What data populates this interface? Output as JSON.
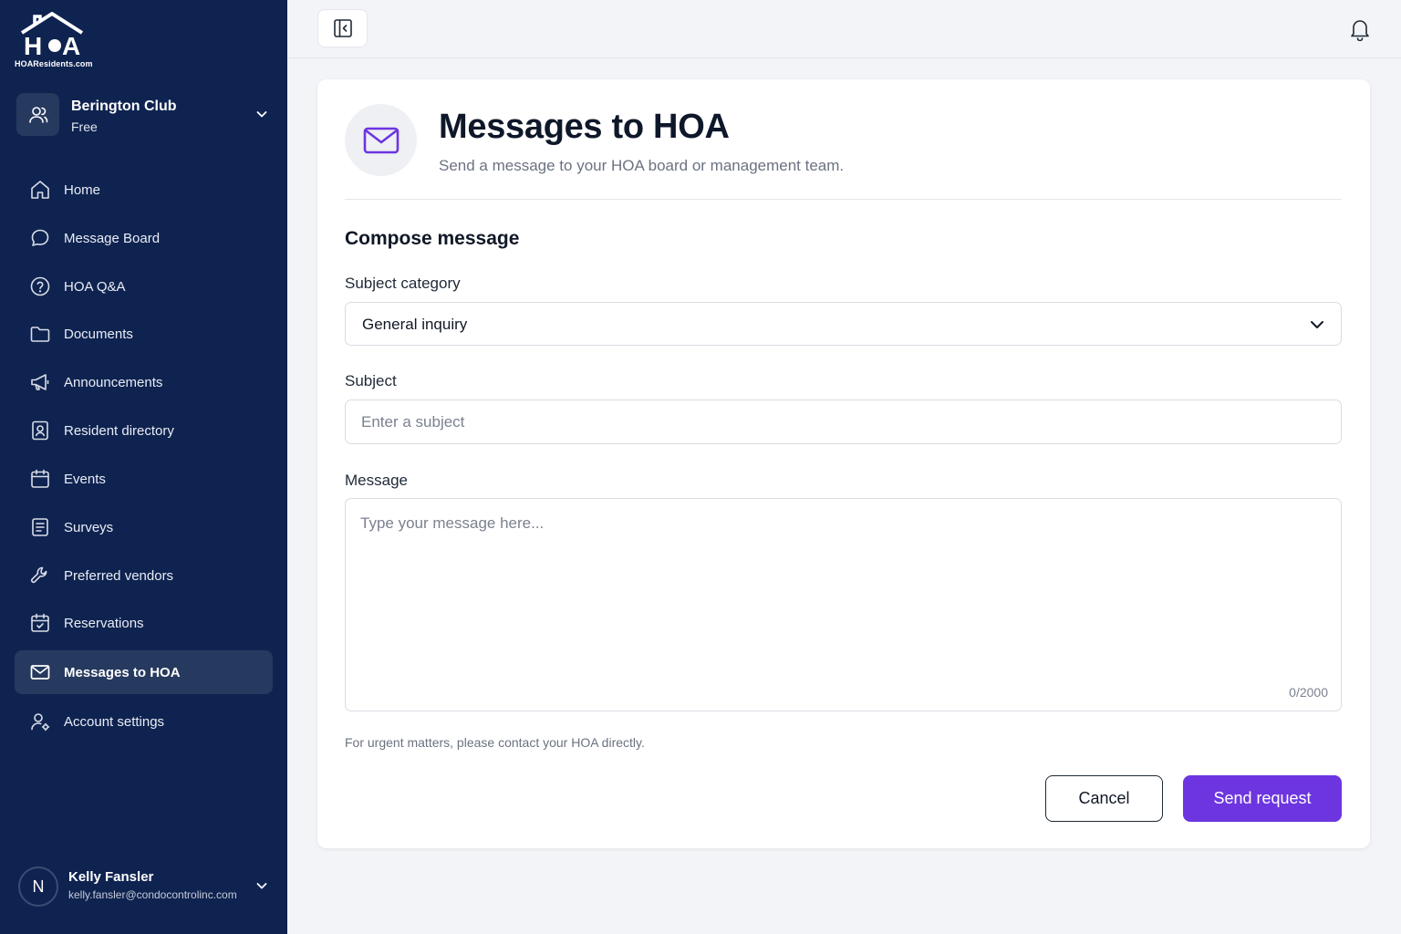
{
  "brand": {
    "logo_text": "HOA",
    "caption": "HOAResidents.com"
  },
  "org": {
    "name": "Berington Club",
    "plan": "Free"
  },
  "nav": [
    {
      "label": "Home",
      "icon": "home-icon"
    },
    {
      "label": "Message Board",
      "icon": "chat-bubble-icon"
    },
    {
      "label": "HOA Q&A",
      "icon": "question-circle-icon"
    },
    {
      "label": "Documents",
      "icon": "folder-icon"
    },
    {
      "label": "Announcements",
      "icon": "megaphone-icon"
    },
    {
      "label": "Resident directory",
      "icon": "contact-card-icon"
    },
    {
      "label": "Events",
      "icon": "calendar-icon"
    },
    {
      "label": "Surveys",
      "icon": "clipboard-list-icon"
    },
    {
      "label": "Preferred vendors",
      "icon": "wrench-icon"
    },
    {
      "label": "Reservations",
      "icon": "calendar-check-icon"
    },
    {
      "label": "Messages to HOA",
      "icon": "envelope-icon",
      "active": true
    },
    {
      "label": "Account settings",
      "icon": "user-gear-icon"
    }
  ],
  "user": {
    "initial": "N",
    "name": "Kelly Fansler",
    "email": "kelly.fansler@condocontrolinc.com"
  },
  "page": {
    "title": "Messages to HOA",
    "subtitle": "Send a message to your HOA board or management team."
  },
  "form": {
    "section_title": "Compose message",
    "category_label": "Subject category",
    "category_value": "General inquiry",
    "subject_label": "Subject",
    "subject_placeholder": "Enter a subject",
    "message_label": "Message",
    "message_placeholder": "Type your message here...",
    "counter": "0/2000",
    "note": "For urgent matters, please contact your HOA directly.",
    "cancel_label": "Cancel",
    "send_label": "Send request"
  },
  "colors": {
    "sidebar_bg": "#0f2350",
    "sidebar_active": "#26395f",
    "accent": "#6d35e0",
    "page_bg": "#f3f4f7"
  }
}
